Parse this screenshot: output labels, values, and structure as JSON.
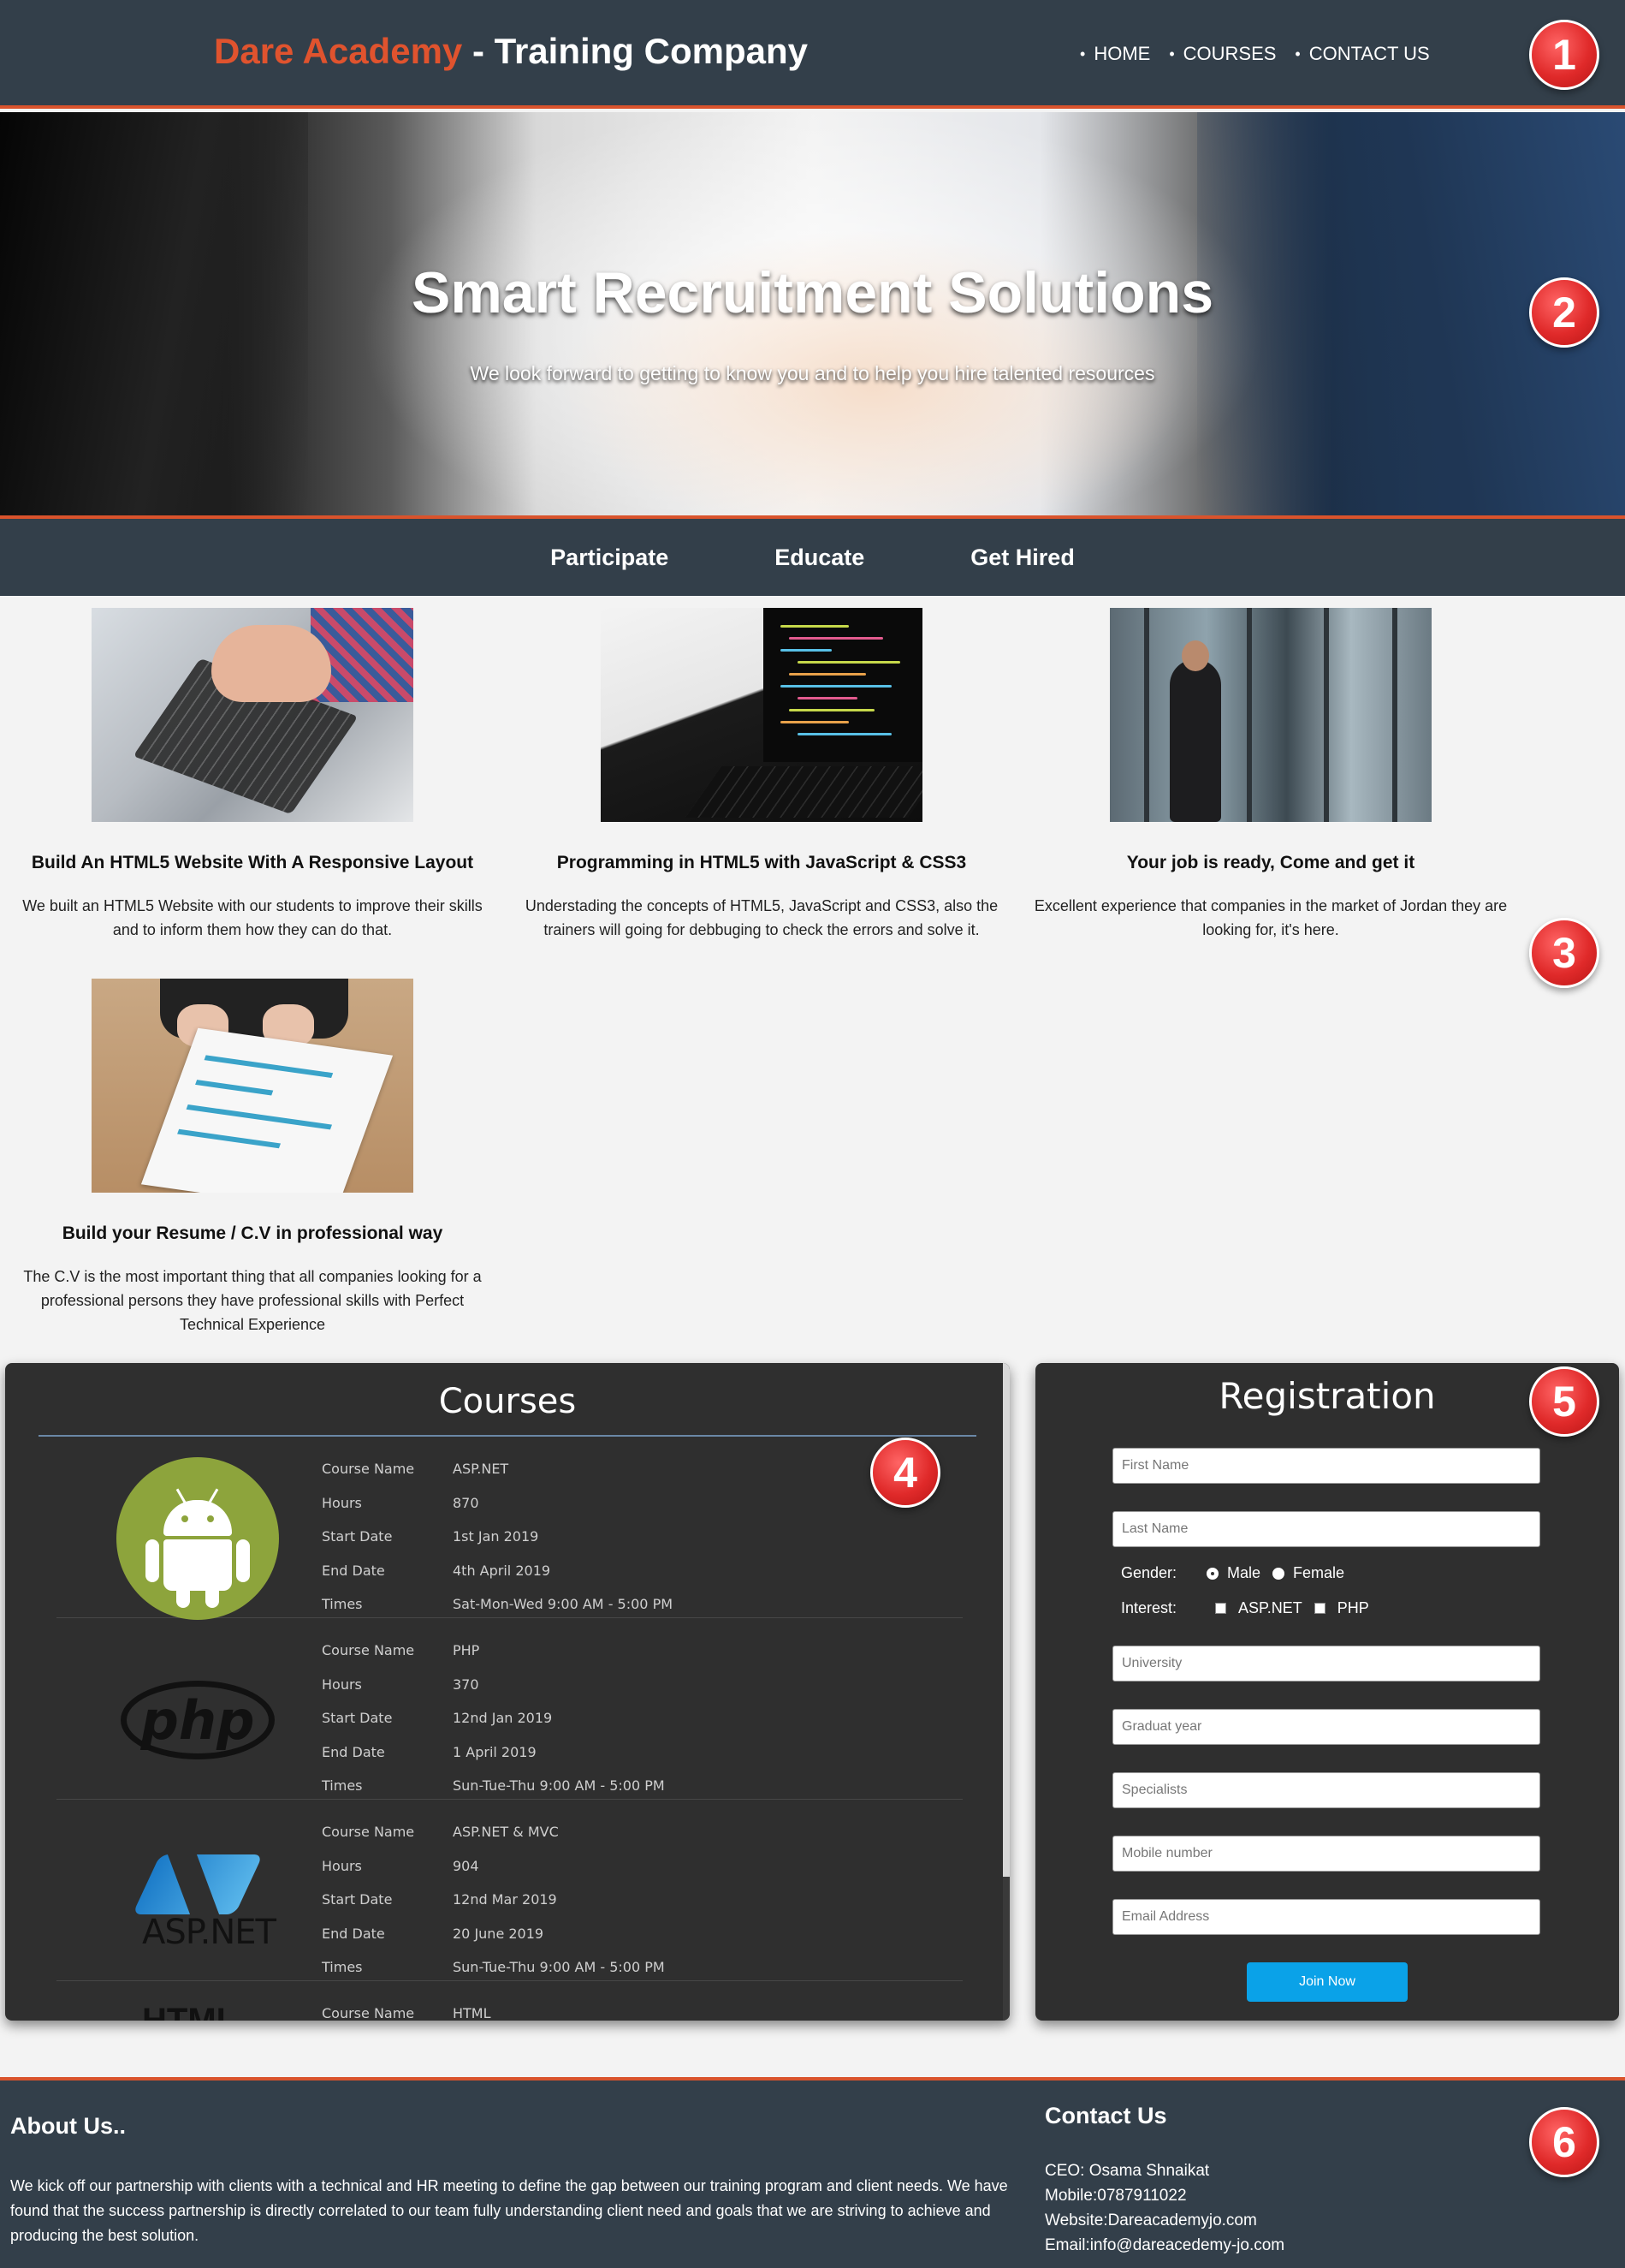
{
  "header": {
    "brand_name": "Dare Academy",
    "brand_suffix": " - Training Company",
    "nav": [
      "HOME",
      "COURSES",
      "CONTACT US"
    ]
  },
  "hero": {
    "title": "Smart Recruitment Solutions",
    "subtitle": "We look forward to getting to know you and to help you hire talented resources"
  },
  "tabs": [
    "Participate",
    "Educate",
    "Get Hired"
  ],
  "services": [
    {
      "title": "Build An HTML5 Website With A Responsive Layout",
      "text": "We built an HTML5 Website with our students to improve their skills and to inform them how they can do that."
    },
    {
      "title": "Programming in HTML5 with JavaScript & CSS3",
      "text": "Understading the concepts of HTML5, JavaScript and CSS3, also the trainers will going for debbuging to check the errors and solve it."
    },
    {
      "title": "Your job is ready, Come and get it",
      "text": "Excellent experience that companies in the market of Jordan they are looking for, it's here."
    },
    {
      "title": "Build your Resume / C.V in professional way",
      "text": "The C.V is the most important thing that all companies looking for a professional persons they have professional skills with Perfect Technical Experience"
    }
  ],
  "courses": {
    "title": "Courses",
    "labels": {
      "name": "Course Name",
      "hours": "Hours",
      "start": "Start Date",
      "end": "End Date",
      "times": "Times"
    },
    "items": [
      {
        "logo": "android-icon",
        "name": "ASP.NET",
        "hours": "870",
        "start": "1st Jan 2019",
        "end": "4th April 2019",
        "times": "Sat-Mon-Wed 9:00 AM - 5:00 PM"
      },
      {
        "logo": "php-logo",
        "logo_text": "php",
        "name": "PHP",
        "hours": "370",
        "start": "12nd Jan 2019",
        "end": "1 April 2019",
        "times": "Sun-Tue-Thu 9:00 AM - 5:00 PM"
      },
      {
        "logo": "aspnet-logo",
        "logo_text": "ASP.NET",
        "name": "ASP.NET & MVC",
        "hours": "904",
        "start": "12nd Mar 2019",
        "end": "20 June 2019",
        "times": "Sun-Tue-Thu 9:00 AM - 5:00 PM"
      },
      {
        "logo": "html-logo",
        "logo_text": "HTML",
        "name": "HTML",
        "hours": "",
        "start": "",
        "end": "",
        "times": ""
      }
    ]
  },
  "registration": {
    "title": "Registration",
    "fields": {
      "first_name": "First Name",
      "last_name": "Last Name",
      "university": "University",
      "grad_year": "Graduat year",
      "specialists": "Specialists",
      "mobile": "Mobile number",
      "email": "Email Address"
    },
    "gender_label": "Gender:",
    "gender_options": [
      "Male",
      "Female"
    ],
    "gender_selected": "Male",
    "interest_label": "Interest:",
    "interest_options": [
      "ASP.NET",
      "PHP"
    ],
    "submit": "Join Now"
  },
  "footer": {
    "about_title": "About Us..",
    "about_text": "We kick off our partnership with clients with a technical and HR meeting to define the gap between our training program and client needs. We have found that the success partnership is directly correlated to our team fully understanding client need and goals that we are striving to achieve and producing the best solution.",
    "contact_title": "Contact Us",
    "ceo": "CEO: Osama Shnaikat",
    "mobile": "Mobile:0787911022",
    "website": "Website:Dareacademyjo.com",
    "email": "Email:info@dareacedemy-jo.com"
  },
  "badges": [
    "1",
    "2",
    "3",
    "4",
    "5",
    "6"
  ],
  "colors": {
    "header_bg": "#333f4a",
    "accent": "#e0532e",
    "panel_bg": "#2f2f2f",
    "button": "#0aa2e8",
    "badge": "#e02a2a"
  }
}
